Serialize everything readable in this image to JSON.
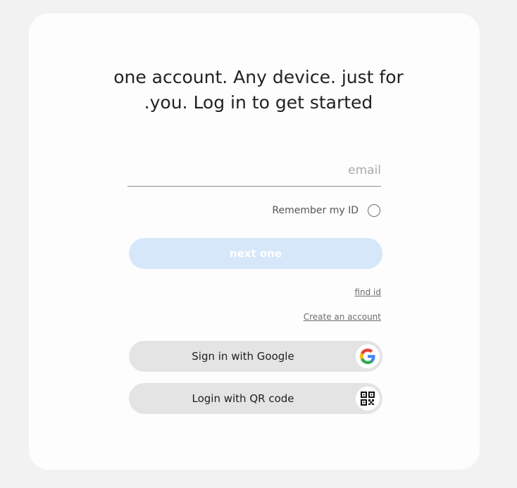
{
  "headline": {
    "line1": "one account. Any device. just for",
    "line2": ".you. Log in to get started"
  },
  "email": {
    "placeholder": "email",
    "value": ""
  },
  "remember": {
    "label": "Remember my ID",
    "checked": false
  },
  "next_button": {
    "label": "next one",
    "enabled": false
  },
  "links": {
    "find_id": "find id",
    "create_account": "Create an account"
  },
  "social": {
    "google": {
      "label": "Sign in with Google",
      "icon": "google-logo-icon"
    },
    "qr": {
      "label": "Login with QR code",
      "icon": "qr-code-icon"
    }
  },
  "colors": {
    "page_background": "#f2f2f2",
    "card_background": "#fdfdfd",
    "next_button_disabled": "#d6e7fa",
    "social_button": "#e4e4e4"
  }
}
